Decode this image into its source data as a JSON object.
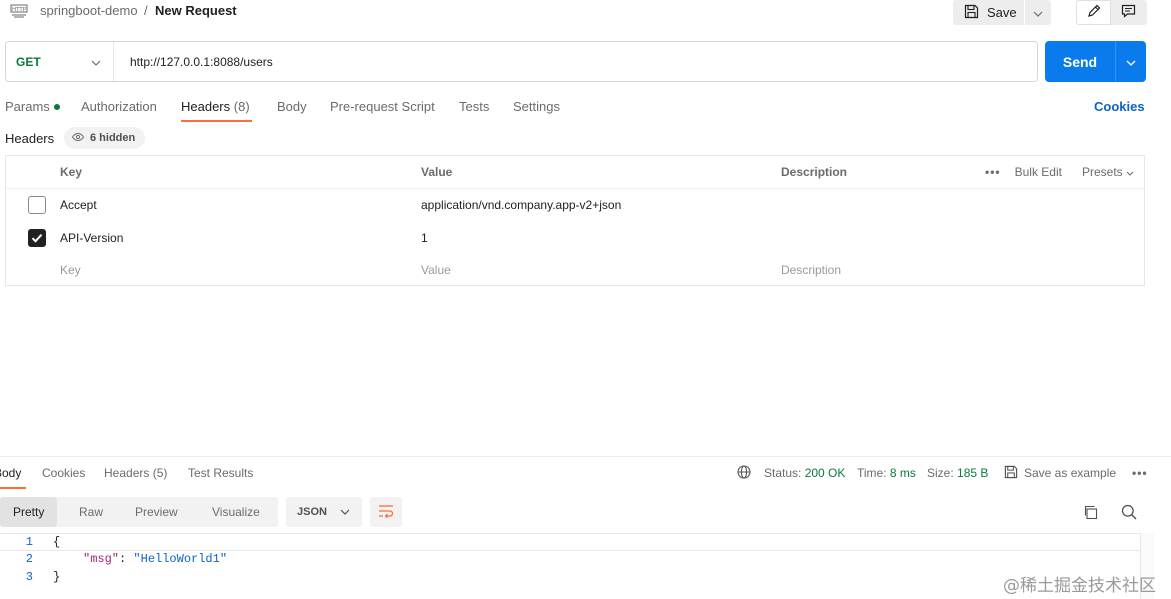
{
  "breadcrumb": {
    "collection": "springboot-demo",
    "separator": "/",
    "request": "New Request"
  },
  "toolbar": {
    "save_label": "Save"
  },
  "request": {
    "method": "GET",
    "url": "http://127.0.0.1:8088/users",
    "send_label": "Send"
  },
  "tabs": [
    {
      "label": "Params",
      "has_dot": true
    },
    {
      "label": "Authorization"
    },
    {
      "label": "Headers",
      "count": "(8)",
      "active": true
    },
    {
      "label": "Body"
    },
    {
      "label": "Pre-request Script"
    },
    {
      "label": "Tests"
    },
    {
      "label": "Settings"
    }
  ],
  "cookies_label": "Cookies",
  "headers_section": {
    "title": "Headers",
    "hidden_label": "6 hidden",
    "columns": {
      "key": "Key",
      "value": "Value",
      "description": "Description"
    },
    "actions": {
      "more": "•••",
      "bulk_edit": "Bulk Edit",
      "presets": "Presets"
    },
    "rows": [
      {
        "checked": false,
        "key": "Accept",
        "value": "application/vnd.company.app-v2+json"
      },
      {
        "checked": true,
        "key": "API-Version",
        "value": "1"
      }
    ],
    "placeholders": {
      "key": "Key",
      "value": "Value",
      "description": "Description"
    }
  },
  "response": {
    "tabs": [
      {
        "label": "Body",
        "active": true
      },
      {
        "label": "Cookies"
      },
      {
        "label": "Headers",
        "count": "(5)"
      },
      {
        "label": "Test Results"
      }
    ],
    "status_label": "Status:",
    "status_value": "200 OK",
    "time_label": "Time:",
    "time_value": "8 ms",
    "size_label": "Size:",
    "size_value": "185 B",
    "save_example": "Save as example",
    "more": "•••",
    "views": [
      "Pretty",
      "Raw",
      "Preview",
      "Visualize"
    ],
    "format": "JSON",
    "code_lines": [
      {
        "num": "1",
        "open": "{"
      },
      {
        "num": "2",
        "key": "\"msg\"",
        "colon": ": ",
        "value": "\"HelloWorld1\""
      },
      {
        "num": "3",
        "close": "}"
      }
    ]
  },
  "watermark": "@稀土掘金技术社区",
  "colors": {
    "accent_orange": "#ff6c37",
    "send_blue": "#097bed",
    "method_green": "#0a7a3e",
    "link_blue": "#0b64c8"
  }
}
